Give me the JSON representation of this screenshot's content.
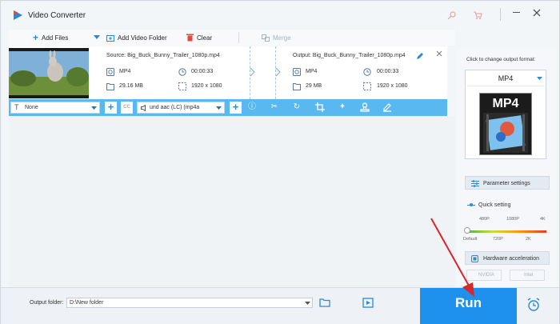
{
  "app": {
    "title": "Video Converter"
  },
  "toolbar": {
    "add_files": "Add Files",
    "add_video_folder": "Add Video Folder",
    "clear": "Clear",
    "merge": "Merge"
  },
  "file": {
    "source_label": "Source: Big_Buck_Bunny_Trailer_1080p.mp4",
    "output_label": "Output: Big_Buck_Bunny_Trailer_1080p.mp4",
    "src_format": "MP4",
    "src_duration": "00:00:33",
    "src_size": "29.16 MB",
    "src_resolution": "1920 x 1080",
    "out_format": "MP4",
    "out_duration": "00:00:33",
    "out_size": "29 MB",
    "out_resolution": "1920 x 1080"
  },
  "editbar": {
    "subtitle_select": "None",
    "audio_select": "und aac (LC) (mp4a"
  },
  "panel": {
    "header": "Click to change output format:",
    "format": "MP4",
    "format_tile_text": "MP4",
    "parameter_settings": "Parameter settings",
    "quick_setting": "Quick setting",
    "scale_top": [
      "480P",
      "1080P",
      "4K"
    ],
    "scale_bottom": [
      "Default",
      "720P",
      "2K"
    ],
    "quick_level": 0,
    "hardware_acceleration": "Hardware acceleration",
    "nvidia": "NVIDIA",
    "intel": "Intel"
  },
  "bottom": {
    "output_folder_label": "Output folder:",
    "output_folder_value": "D:\\New folder",
    "run": "Run"
  },
  "colors": {
    "accent": "#2196f3",
    "run": "#1e90ee",
    "editbar": "#59b8ef",
    "arrow": "#d8262b"
  }
}
